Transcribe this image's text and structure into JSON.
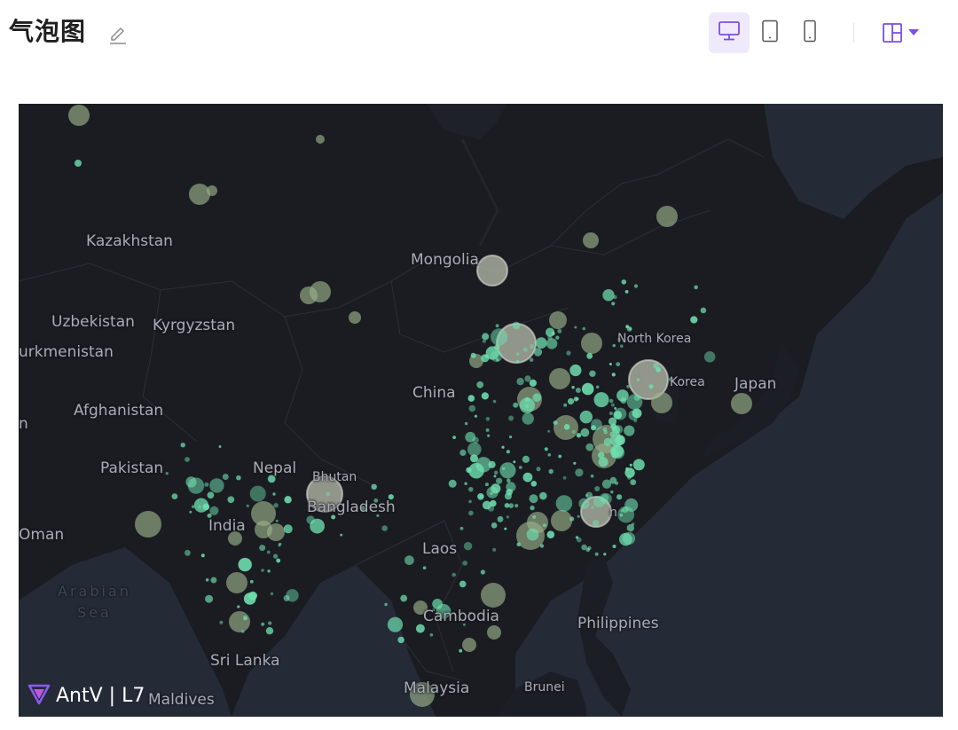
{
  "header": {
    "title": "气泡图",
    "edit_icon": "pencil-icon",
    "devices": [
      {
        "name": "desktop",
        "icon": "monitor-icon",
        "active": true
      },
      {
        "name": "tablet",
        "icon": "tablet-icon",
        "active": false
      },
      {
        "name": "mobile",
        "icon": "phone-icon",
        "active": false
      }
    ],
    "layout_icon": "layout-icon",
    "accent_color": "#7b4fe0"
  },
  "map": {
    "labels": {
      "kazakhstan": "Kazakhstan",
      "mongolia": "Mongolia",
      "uzbekistan": "Uzbekistan",
      "kyrgyzstan": "Kyrgyzstan",
      "turkmenistan": "urkmenistan",
      "afghanistan": "Afghanistan",
      "iran": "n",
      "pakistan": "Pakistan",
      "nepal": "Nepal",
      "bhutan": "Bhutan",
      "bangladesh": "Bangladesh",
      "india": "India",
      "oman": "Oman",
      "china": "China",
      "north_korea": "North Korea",
      "korea": "Korea",
      "japan": "Japan",
      "taiwan": "n",
      "laos": "Laos",
      "cambodia": "Cambodia",
      "philippines": "Philippines",
      "sri_lanka": "Sri Lanka",
      "maldives": "Maldives",
      "malaysia": "Malaysia",
      "brunei": "Brunei",
      "arabian_sea": "Arabian",
      "arabian_sea2": "Sea"
    },
    "logo_text": "AntV | L7",
    "bubble_color": "#6fe0b0",
    "large_bubble_color": "#9ab08a"
  }
}
